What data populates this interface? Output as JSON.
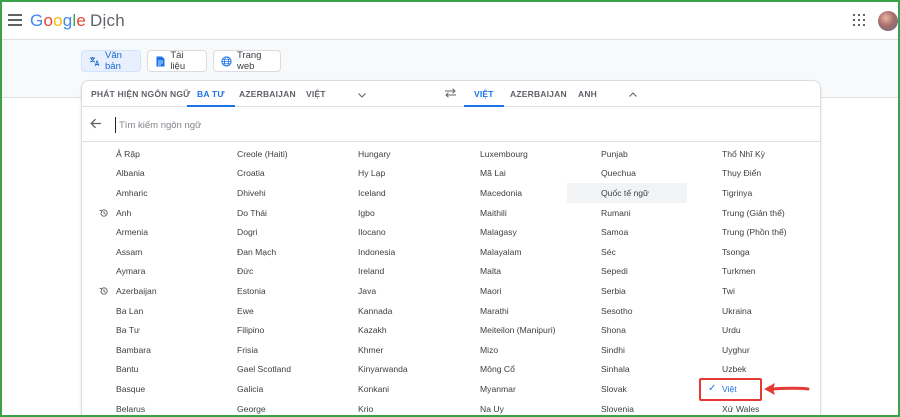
{
  "header": {
    "logo_letters": [
      "G",
      "o",
      "o",
      "g",
      "l",
      "e"
    ],
    "product_name": "Dịch"
  },
  "modes": [
    {
      "label": "Văn bản",
      "icon": "translate-icon"
    },
    {
      "label": "Tài liệu",
      "icon": "document-icon"
    },
    {
      "label": "Trang web",
      "icon": "globe-icon"
    }
  ],
  "source_tabs": [
    "PHÁT HIỆN NGÔN NGỮ",
    "BA TƯ",
    "AZERBAIJAN",
    "VIỆT"
  ],
  "target_tabs": [
    "VIỆT",
    "AZERBAIJAN",
    "ANH"
  ],
  "search": {
    "placeholder": "Tìm kiếm ngôn ngữ"
  },
  "columns": [
    [
      "Ả Rập",
      "Albania",
      "Amharic",
      "Anh",
      "Armenia",
      "Assam",
      "Aymara",
      "Azerbaijan",
      "Ba Lan",
      "Ba Tư",
      "Bambara",
      "Bantu",
      "Basque",
      "Belarus"
    ],
    [
      "Creole (Haiti)",
      "Croatia",
      "Dhivehi",
      "Do Thái",
      "Dogri",
      "Đan Mạch",
      "Đức",
      "Estonia",
      "Ewe",
      "Filipino",
      "Frisia",
      "Gael Scotland",
      "Galicia",
      "George"
    ],
    [
      "Hungary",
      "Hy Lạp",
      "Iceland",
      "Igbo",
      "Ilocano",
      "Indonesia",
      "Ireland",
      "Java",
      "Kannada",
      "Kazakh",
      "Khmer",
      "Kinyarwanda",
      "Konkani",
      "Krio"
    ],
    [
      "Luxembourg",
      "Mã Lai",
      "Macedonia",
      "Maithili",
      "Malagasy",
      "Malayalam",
      "Malta",
      "Maori",
      "Marathi",
      "Meiteilon (Manipuri)",
      "Mizo",
      "Mông Cổ",
      "Myanmar",
      "Na Uy"
    ],
    [
      "Punjab",
      "Quechua",
      "Quốc tế ngữ",
      "Rumani",
      "Samoa",
      "Séc",
      "Sepedi",
      "Serbia",
      "Sesotho",
      "Shona",
      "Sindhi",
      "Sinhala",
      "Slovak",
      "Slovenia"
    ],
    [
      "Thổ Nhĩ Kỳ",
      "Thụy Điển",
      "Tigrinya",
      "Trung (Giản thể)",
      "Trung (Phồn thể)",
      "Tsonga",
      "Turkmen",
      "Twi",
      "Ukraina",
      "Urdu",
      "Uyghur",
      "Uzbek",
      "Việt",
      "Xứ Wales"
    ]
  ],
  "recent_languages": [
    "Anh",
    "Azerbaijan"
  ],
  "highlighted_language": "Quốc tế ngữ",
  "selected_language": "Việt",
  "colors": {
    "accent": "#1a73e8",
    "callout": "#e53935",
    "frame": "#3aa34a"
  }
}
